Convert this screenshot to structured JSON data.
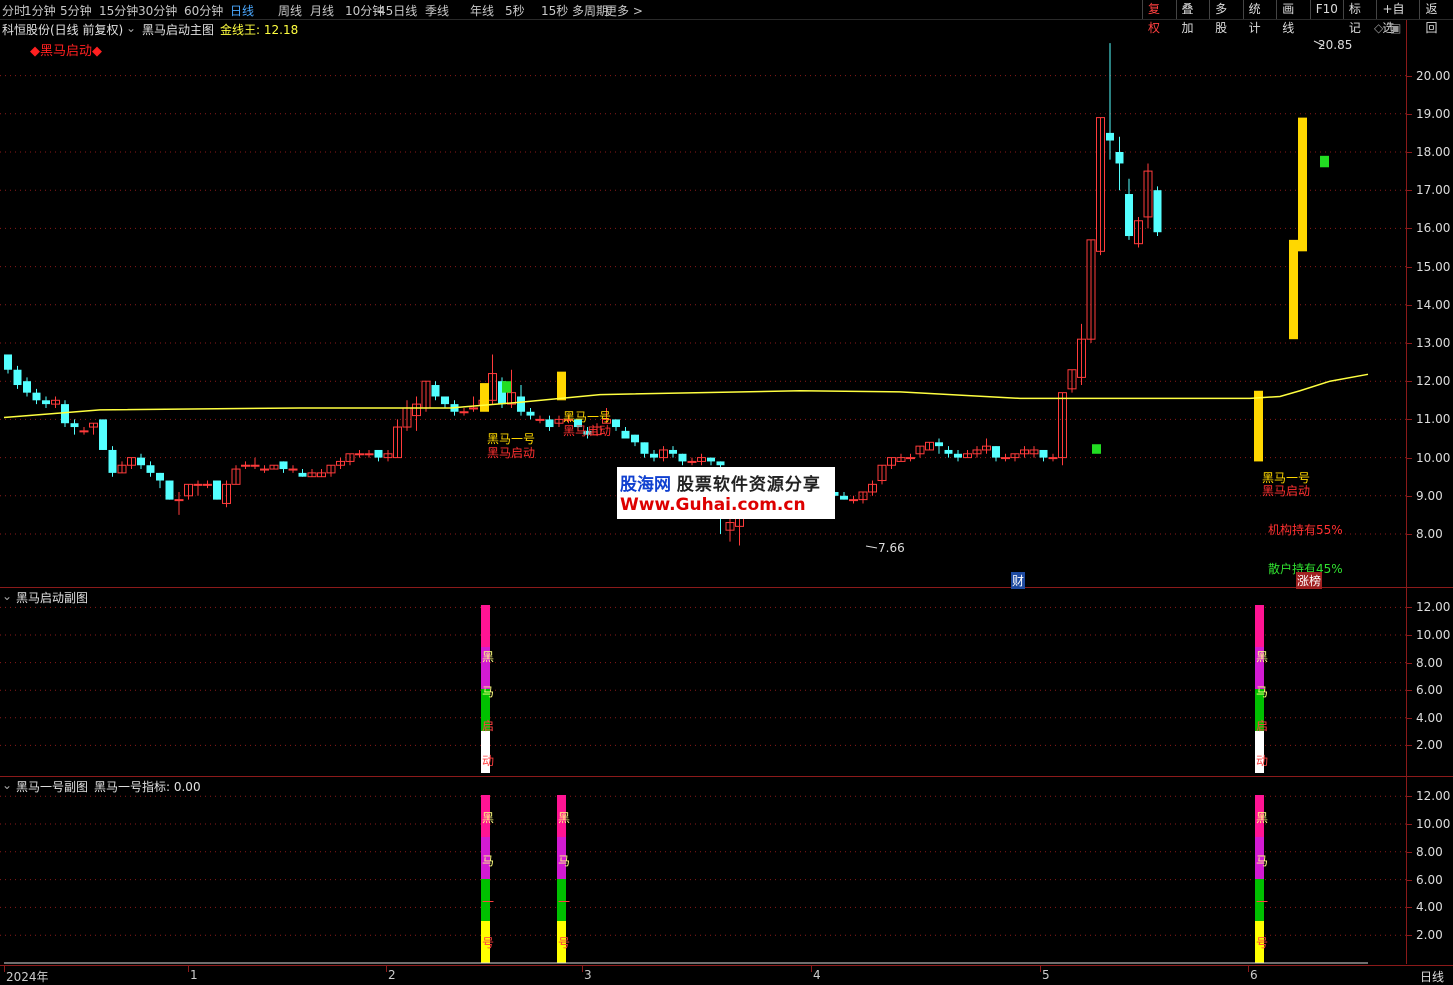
{
  "toolbar": {
    "periods": [
      "分时",
      "1分钟",
      "5分钟",
      "15分钟",
      "30分钟",
      "60分钟",
      "日线",
      "周线",
      "月线",
      "10分钟",
      "45日线",
      "季线",
      "年线",
      "5秒",
      "15秒",
      "多周期",
      "更多 >"
    ],
    "active": "日线",
    "right_buttons": [
      "复权",
      "叠加",
      "多股",
      "统计",
      "画线",
      "F10",
      "标记",
      "+自选",
      "返回"
    ],
    "right_active": "复权"
  },
  "main": {
    "stock_title": "科恒股份(日线 前复权)",
    "indicator_name": "黑马启动主图",
    "indicator_value_label": "金线王: 12.18",
    "legend": "◆黑马启动◆",
    "high_label": "20.85",
    "low_label": "7.66",
    "institution_label": "机构持有55%",
    "retail_label": "散户持有45%",
    "cai_badge": "财",
    "zhangbang_badge": "涨榜",
    "signal_labels": [
      "黑马启动",
      "黑马一号"
    ],
    "y_axis": [
      "20.00",
      "19.00",
      "18.00",
      "17.00",
      "16.00",
      "15.00",
      "14.00",
      "13.00",
      "12.00",
      "11.00",
      "10.00",
      "9.00",
      "8.00"
    ]
  },
  "sub1": {
    "title": "黑马启动副图",
    "chars": [
      "黑",
      "马",
      "启",
      "动"
    ],
    "y_axis": [
      "12.00",
      "10.00",
      "8.00",
      "6.00",
      "4.00",
      "2.00"
    ]
  },
  "sub2": {
    "title": "黑马一号副图",
    "value_label": "黑马一号指标: 0.00",
    "chars": [
      "黑",
      "马",
      "一",
      "号"
    ],
    "y_axis": [
      "12.00",
      "10.00",
      "8.00",
      "6.00",
      "4.00",
      "2.00"
    ]
  },
  "watermark": {
    "brand": "股海网",
    "slogan": "股票软件资源分享",
    "url": "Www.Guhai.com.cn"
  },
  "x_axis": {
    "labels": [
      "2024年",
      "1",
      "2",
      "3",
      "4",
      "5",
      "6"
    ],
    "period": "日线"
  },
  "colors": {
    "up": "#ff3b3b",
    "down": "#54ffff",
    "ma": "#ffff40",
    "grid": "#8b1a1a",
    "signal": "#ffd700",
    "bar_pink": "#ff1493",
    "bar_magenta": "#d21bd2",
    "bar_green": "#00c000",
    "bar_white": "#ffffff",
    "bar_yellow": "#ffff00"
  }
}
